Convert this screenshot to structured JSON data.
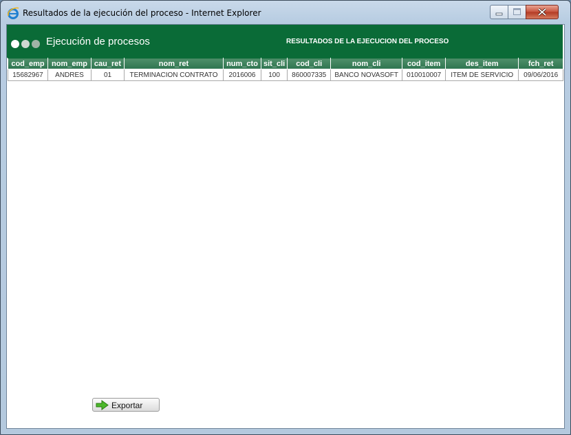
{
  "window": {
    "title": "Resultados de la ejecución del proceso - Internet Explorer"
  },
  "header": {
    "title": "Ejecución de procesos",
    "subtitle": "RESULTADOS DE LA EJECUCION DEL PROCESO",
    "color": "#0a6b37"
  },
  "table": {
    "columns": [
      "cod_emp",
      "nom_emp",
      "cau_ret",
      "nom_ret",
      "num_cto",
      "sit_cli",
      "cod_cli",
      "nom_cli",
      "cod_item",
      "des_item",
      "fch_ret"
    ],
    "rows": [
      [
        "15682967",
        "ANDRES",
        "01",
        "TERMINACION CONTRATO",
        "2016006",
        "100",
        "860007335",
        "BANCO NOVASOFT",
        "010010007",
        "ITEM DE SERVICIO",
        "09/06/2016"
      ]
    ]
  },
  "footer": {
    "export_label": "Exportar",
    "export_icon": "green-arrow-right-icon"
  }
}
